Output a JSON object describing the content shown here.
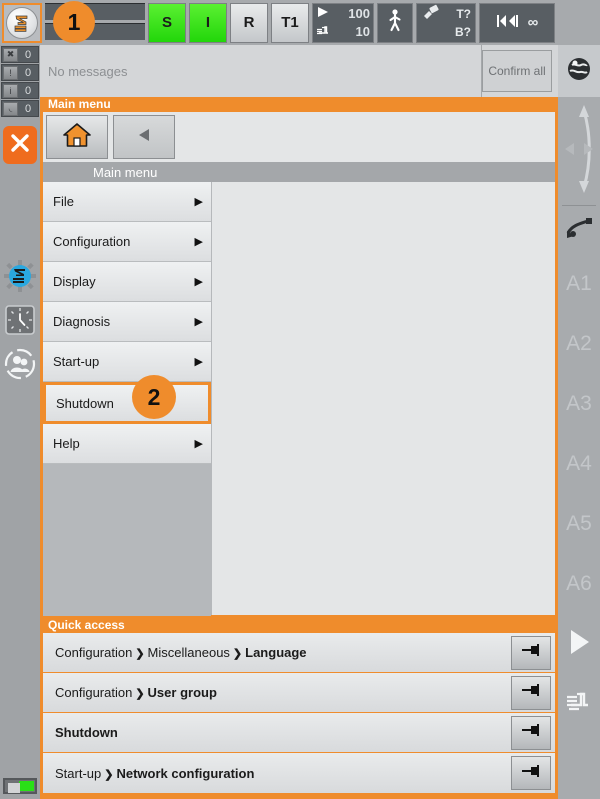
{
  "toolbar": {
    "robot_logo": "kuka-robot-logo",
    "status_bars": [
      "",
      ""
    ],
    "buttons": [
      {
        "label": "S",
        "style": "green",
        "name": "submit-interpreter-button"
      },
      {
        "label": "I",
        "style": "green",
        "name": "robot-interpreter-button"
      },
      {
        "label": "R",
        "style": "grey",
        "name": "drives-ready-button"
      },
      {
        "label": "T1",
        "style": "grey",
        "name": "operating-mode-button"
      }
    ],
    "speed": {
      "program_override": "100",
      "jog_override": "10"
    },
    "person_icon": "walking-person-icon",
    "tool": {
      "tool_label": "T?",
      "base_label": "B?"
    },
    "increment": {
      "icon": "increment-icon",
      "value": "∞"
    }
  },
  "badges": {
    "one": "1",
    "two": "2"
  },
  "left_rail": {
    "counters": [
      {
        "icon": "error-icon",
        "count": "0"
      },
      {
        "icon": "warning-icon",
        "count": "0"
      },
      {
        "icon": "info-icon",
        "count": "0"
      },
      {
        "icon": "wait-icon",
        "count": "0"
      }
    ],
    "stop_button": "stop-close-button",
    "icons": [
      "robot-settings-gear-icon",
      "clock-icon",
      "user-group-icon"
    ],
    "battery": "battery-indicator"
  },
  "message_bar": {
    "text": "No messages",
    "confirm_label": "Confirm all"
  },
  "main_panel": {
    "title": "Main menu",
    "home_icon": "home-icon",
    "back_icon": "back-arrow-icon",
    "breadcrumb": "Main menu",
    "items": [
      {
        "label": "File",
        "has_arrow": true,
        "selected": false
      },
      {
        "label": "Configuration",
        "has_arrow": true,
        "selected": false
      },
      {
        "label": "Display",
        "has_arrow": true,
        "selected": false
      },
      {
        "label": "Diagnosis",
        "has_arrow": true,
        "selected": false
      },
      {
        "label": "Start-up",
        "has_arrow": true,
        "selected": false
      },
      {
        "label": "Shutdown",
        "has_arrow": false,
        "selected": true
      },
      {
        "label": "Help",
        "has_arrow": true,
        "selected": false
      }
    ]
  },
  "quick_access": {
    "title": "Quick access",
    "rows": [
      {
        "parts": [
          {
            "t": "Configuration",
            "b": false
          },
          {
            "t": "Miscellaneous",
            "b": false
          },
          {
            "t": "Language",
            "b": true
          }
        ],
        "pin": "pin-icon"
      },
      {
        "parts": [
          {
            "t": "Configuration",
            "b": false
          },
          {
            "t": "User group",
            "b": true
          }
        ],
        "pin": "pin-icon"
      },
      {
        "parts": [
          {
            "t": "Shutdown",
            "b": true
          }
        ],
        "pin": "pin-icon"
      },
      {
        "parts": [
          {
            "t": "Start-up",
            "b": false
          },
          {
            "t": "Network configuration",
            "b": true
          }
        ],
        "pin": "pin-icon"
      }
    ]
  },
  "right_rail": {
    "world_icon": "world-globe-icon",
    "jog_icon": "jog-direction-icon",
    "tool_icon": "robot-tool-icon",
    "axes": [
      "A1",
      "A2",
      "A3",
      "A4",
      "A5",
      "A6"
    ],
    "play_icon": "play-icon",
    "hand_icon": "hand-icon"
  },
  "colors": {
    "accent_orange": "#ef8c2c",
    "stop_orange": "#ef6c1e",
    "green": "#2ad60a",
    "panel_grey": "#e4e6e7",
    "rail_grey": "#a0a3a6"
  }
}
